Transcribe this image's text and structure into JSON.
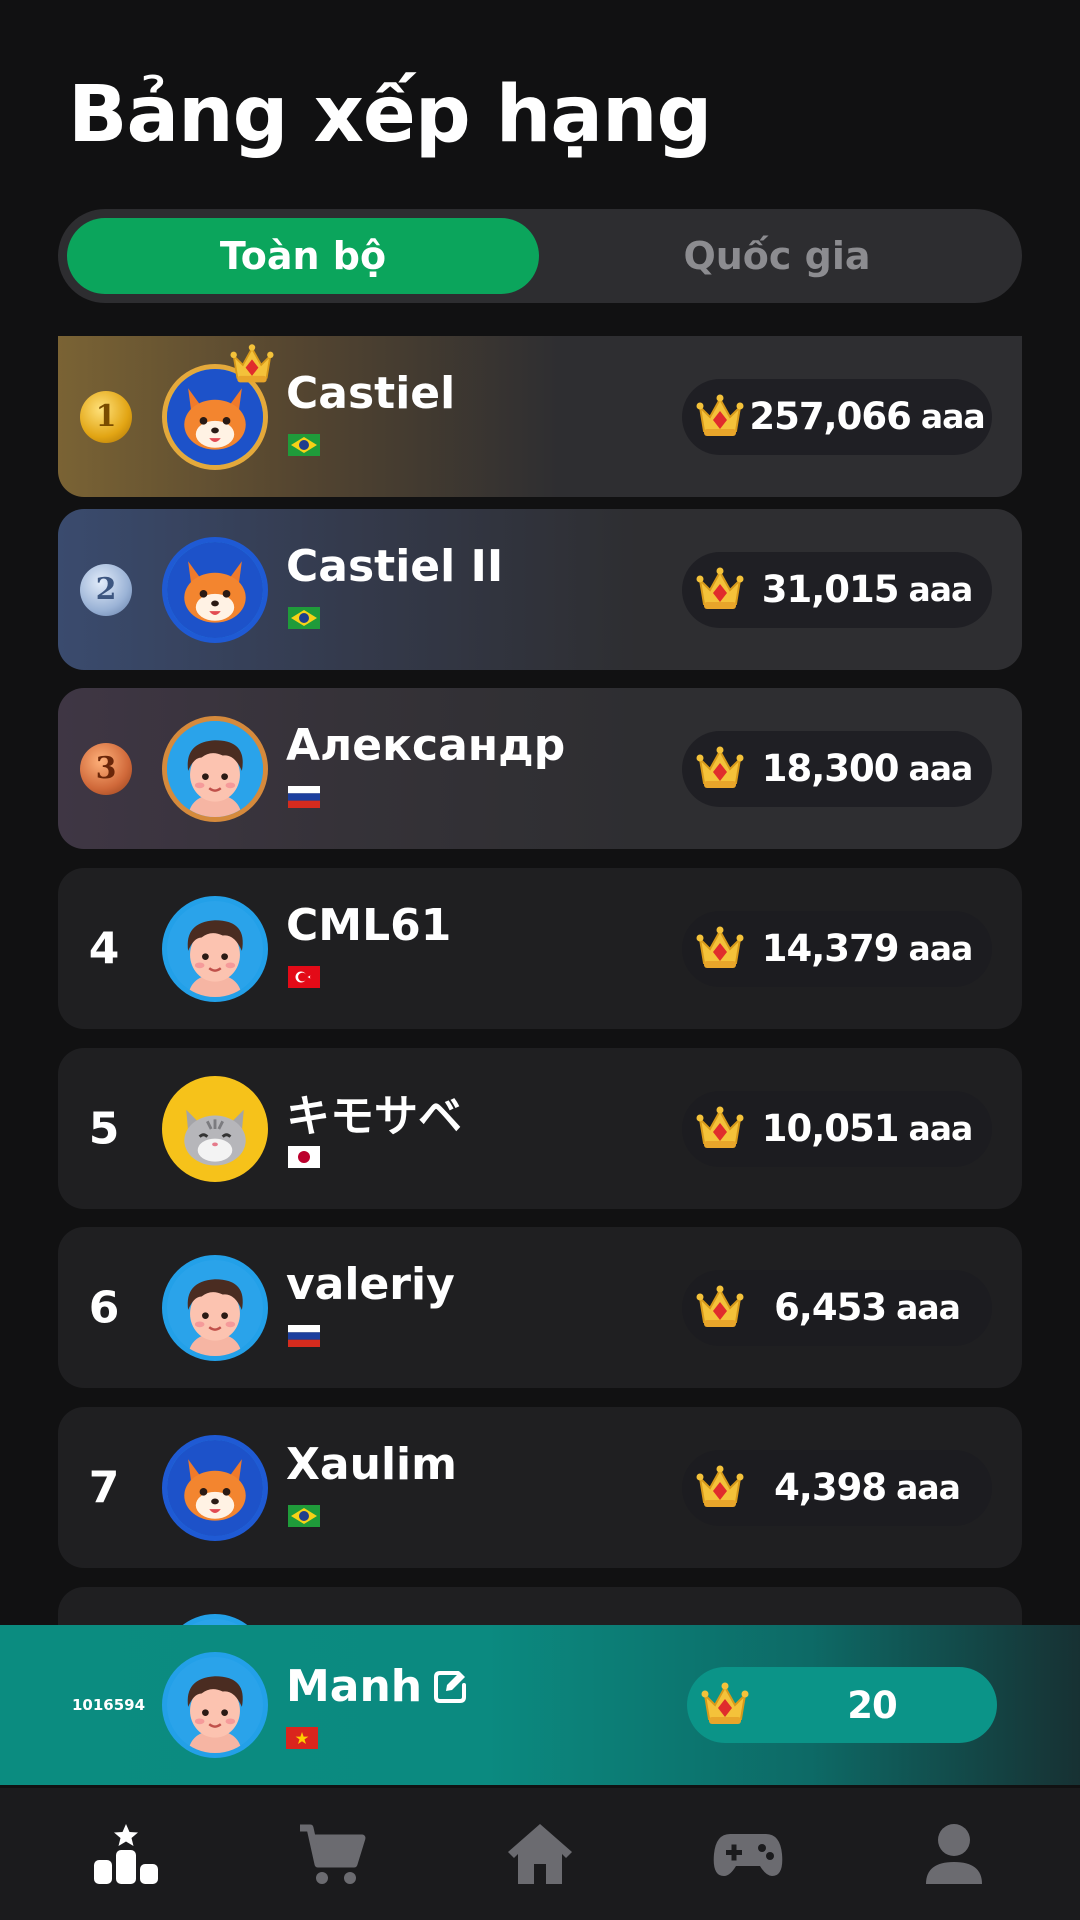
{
  "title": "Bảng xếp hạng",
  "tabs": [
    {
      "label": "Toàn bộ",
      "active": true
    },
    {
      "label": "Quốc gia",
      "active": false
    }
  ],
  "score_unit": "aaa",
  "leaderboard": [
    {
      "rank": "1",
      "name": "Castiel",
      "country": "Brazil",
      "score": "257,066"
    },
    {
      "rank": "2",
      "name": "Castiel II",
      "country": "Brazil",
      "score": "31,015"
    },
    {
      "rank": "3",
      "name": "Александр",
      "country": "Russia",
      "score": "18,300"
    },
    {
      "rank": "4",
      "name": "CML61",
      "country": "Turkey",
      "score": "14,379"
    },
    {
      "rank": "5",
      "name": "キモサベ",
      "country": "Japan",
      "score": "10,051"
    },
    {
      "rank": "6",
      "name": "valeriy",
      "country": "Russia",
      "score": "6,453"
    },
    {
      "rank": "7",
      "name": "Xaulim",
      "country": "Brazil",
      "score": "4,398"
    }
  ],
  "current_user": {
    "rank": "1016594",
    "name": "Manh",
    "country": "Vietnam",
    "score": "20"
  },
  "nav": [
    "leaderboard-icon",
    "cart-icon",
    "home-icon",
    "gamepad-icon",
    "profile-icon"
  ],
  "colors": {
    "accent": "#0ba55c",
    "background": "#111112",
    "current_user": "#0b8c80",
    "crown": "#f4c23a"
  }
}
